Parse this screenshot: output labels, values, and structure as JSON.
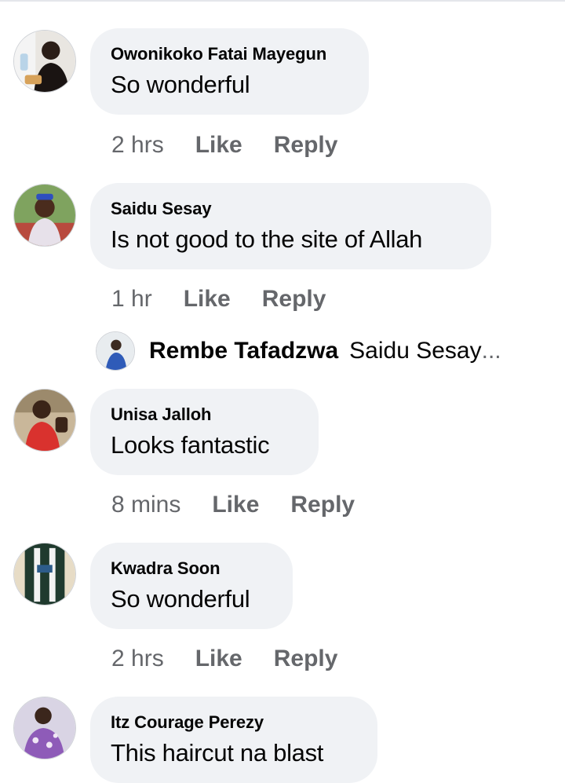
{
  "comments": [
    {
      "author": "Owonikoko Fatai Mayegun",
      "text": "So wonderful",
      "time": "2 hrs",
      "like": "Like",
      "reply": "Reply"
    },
    {
      "author": "Saidu Sesay",
      "text": "Is not good to the site of Allah",
      "time": "1 hr",
      "like": "Like",
      "reply": "Reply",
      "reply_preview": {
        "author": "Rembe Tafadzwa",
        "text": "Saidu Sesay",
        "ellipsis": "..."
      }
    },
    {
      "author": "Unisa Jalloh",
      "text": "Looks fantastic",
      "time": "8 mins",
      "like": "Like",
      "reply": "Reply"
    },
    {
      "author": "Kwadra Soon",
      "text": "So wonderful",
      "time": "2 hrs",
      "like": "Like",
      "reply": "Reply"
    },
    {
      "author": "Itz Courage Perezy",
      "text": "This haircut na blast"
    }
  ],
  "colors": {
    "bubble_bg": "#f0f2f5",
    "meta_text": "#65676b",
    "primary_text": "#050505"
  }
}
